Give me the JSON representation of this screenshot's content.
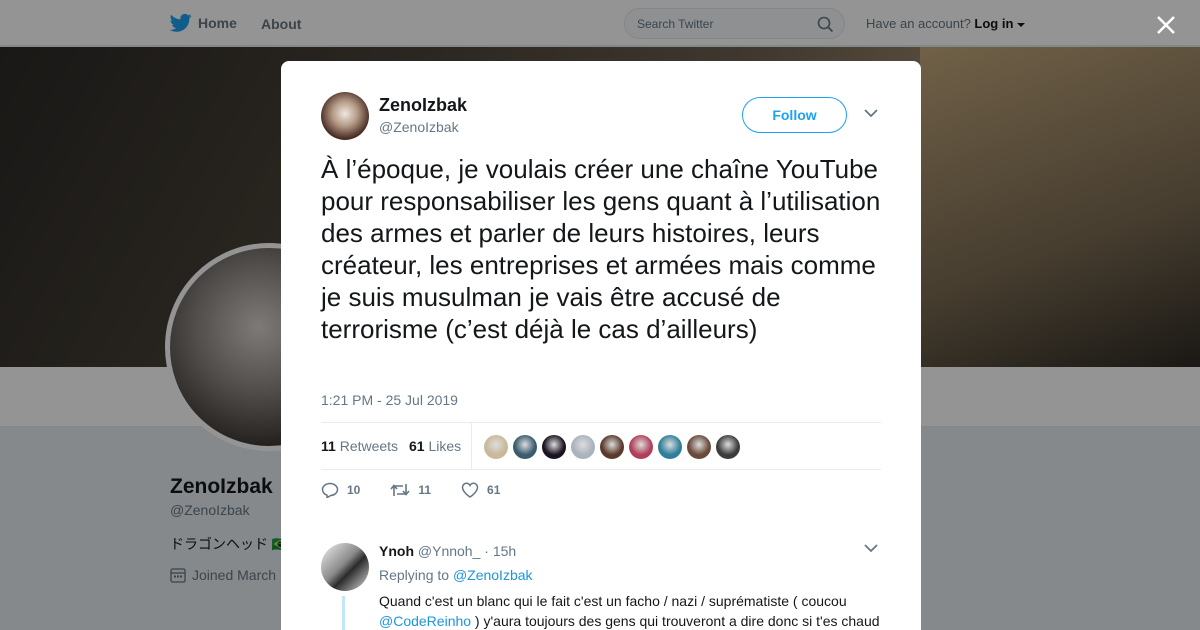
{
  "nav": {
    "home_label": "Home",
    "about_label": "About",
    "search_placeholder": "Search Twitter",
    "have_account": "Have an account?",
    "login_label": "Log in"
  },
  "profile": {
    "name": "ZenoIzbak",
    "handle": "@ZenoIzbak",
    "bio": "ドラゴンヘッド 🇧🇷",
    "joined": "Joined March"
  },
  "tweet": {
    "author_name": "ZenoIzbak",
    "author_handle": "@ZenoIzbak",
    "follow_label": "Follow",
    "text": "À l’époque, je voulais créer une chaîne YouTube pour responsabiliser les gens quant à l’utilisation des armes et parler de leurs histoires, leurs créateur, les entreprises et armées mais comme je suis musulman je vais être accusé de terrorisme (c’est déjà le cas d’ailleurs)",
    "timestamp": "1:21 PM - 25 Jul 2019",
    "retweets_count": "11",
    "retweets_label": "Retweets",
    "likes_count": "61",
    "likes_label": "Likes",
    "reply_action_count": "10",
    "retweet_action_count": "11",
    "like_action_count": "61",
    "liker_colors": [
      "#c9b89a",
      "#3b5b6e",
      "#1a1320",
      "#aab3bc",
      "#5a3a2a",
      "#b0405a",
      "#2f7f9a",
      "#6a4a3a",
      "#3c3c3c"
    ]
  },
  "reply": {
    "name": "Ynoh",
    "handle": "@Ynnoh_",
    "time": "· 15h",
    "replying_prefix": "Replying to",
    "replying_to": "@ZenoIzbak",
    "text_part1": "Quand c'est un blanc qui le fait c'est un facho / nazi / suprématiste ( coucou",
    "mention": "@CodeReinho",
    "text_part2": " ) y'aura toujours des gens qui trouveront a dire donc si t'es chaud"
  },
  "colors": {
    "accent": "#1da1f2",
    "muted": "#657786",
    "text": "#14171a"
  }
}
